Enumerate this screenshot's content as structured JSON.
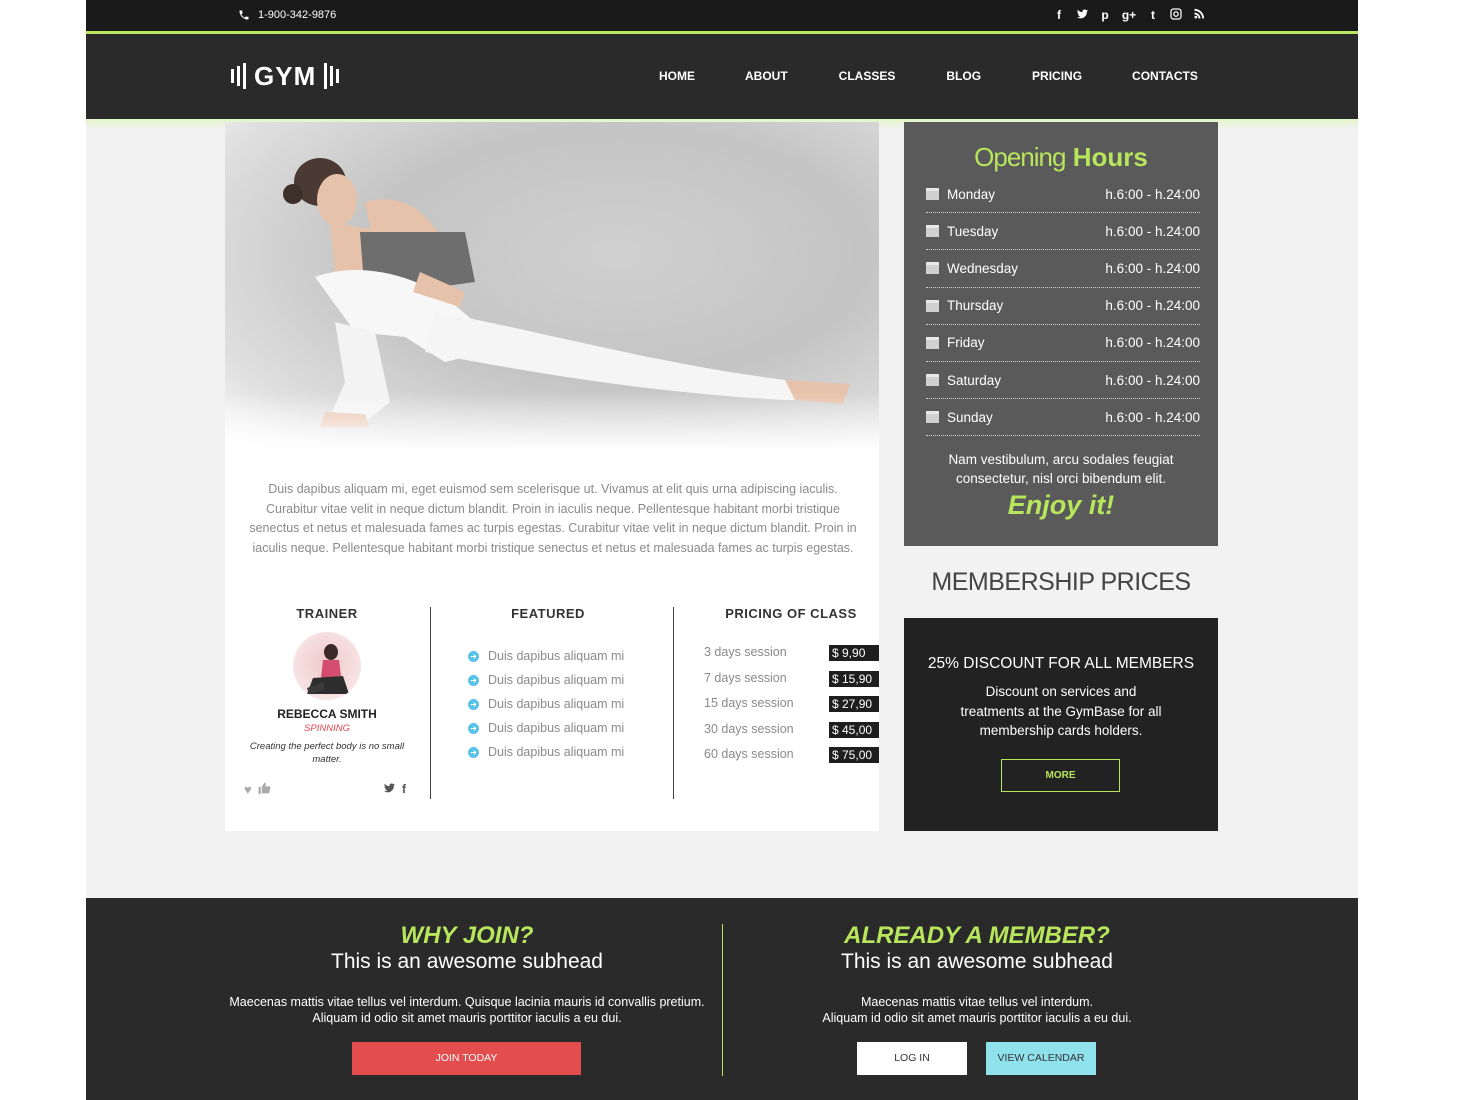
{
  "topbar": {
    "phone": "1-900-342-9876",
    "social_icons": [
      "facebook-icon",
      "twitter-icon",
      "pinterest-icon",
      "google-plus-icon",
      "tumblr-icon",
      "instagram-icon",
      "rss-icon"
    ]
  },
  "header": {
    "logo": "GYM",
    "nav": [
      "HOME",
      "ABOUT",
      "CLASSES",
      "BLOG",
      "PRICING",
      "CONTACTS"
    ]
  },
  "main": {
    "intro": "Duis dapibus aliquam mi, eget euismod sem scelerisque ut. Vivamus at elit quis urna adipiscing iaculis. Curabitur vitae velit in neque dictum blandit. Proin in iaculis neque. Pellentesque habitant morbi tristique senectus et netus et malesuada fames ac turpis egestas. Curabitur vitae velit in neque dictum blandit. Proin in iaculis neque. Pellentesque habitant morbi tristique senectus et netus et malesuada fames ac turpis egestas.",
    "trainer": {
      "heading": "TRAINER",
      "name": "REBECCA SMITH",
      "role": "SPINNING",
      "quote": "Creating the perfect body is no small matter."
    },
    "featured": {
      "heading": "FEATURED",
      "items": [
        "Duis dapibus aliquam mi",
        "Duis dapibus aliquam mi",
        "Duis dapibus aliquam mi",
        "Duis dapibus aliquam mi",
        "Duis dapibus aliquam mi"
      ]
    },
    "pricing": {
      "heading": "PRICING OF CLASS",
      "items": [
        {
          "label": "3 days session",
          "price": "$ 9,90"
        },
        {
          "label": "7 days session",
          "price": "$ 15,90"
        },
        {
          "label": "15 days session",
          "price": "$ 27,90"
        },
        {
          "label": "30 days session",
          "price": "$ 45,00"
        },
        {
          "label": "60 days session",
          "price": "$ 75,00"
        }
      ]
    }
  },
  "hours": {
    "title_light": "Opening",
    "title_bold": "Hours",
    "days": [
      {
        "day": "Monday",
        "time": "h.6:00 - h.24:00"
      },
      {
        "day": "Tuesday",
        "time": "h.6:00 - h.24:00"
      },
      {
        "day": "Wednesday",
        "time": "h.6:00 - h.24:00"
      },
      {
        "day": "Thursday",
        "time": "h.6:00 - h.24:00"
      },
      {
        "day": "Friday",
        "time": "h.6:00 - h.24:00"
      },
      {
        "day": "Saturday",
        "time": "h.6:00 - h.24:00"
      },
      {
        "day": "Sunday",
        "time": "h.6:00 - h.24:00"
      }
    ],
    "note": "Nam vestibulum, arcu sodales feugiat consectetur, nisl orci bibendum elit.",
    "enjoy": "Enjoy it!"
  },
  "membership": {
    "title": "MEMBERSHIP PRICES",
    "discount_title": "25% DISCOUNT FOR ALL MEMBERS",
    "discount_text": "Discount on services and treatments at the GymBase for all membership cards holders.",
    "more": "MORE"
  },
  "footer": {
    "left": {
      "heading": "WHY JOIN?",
      "subhead": "This is an awesome subhead",
      "text_line1": "Maecenas mattis vitae tellus vel interdum. Quisque lacinia mauris id convallis pretium.",
      "text_line2": "Aliquam id odio sit amet mauris porttitor iaculis a eu dui.",
      "button": "JOIN TODAY"
    },
    "right": {
      "heading": "ALREADY A MEMBER?",
      "subhead": "This is an awesome subhead",
      "text_line1": "Maecenas mattis vitae tellus vel interdum.",
      "text_line2": "Aliquam id odio sit amet mauris porttitor iaculis a eu dui.",
      "login": "LOG IN",
      "calendar": "VIEW CALENDAR"
    }
  },
  "colors": {
    "accent": "#b7e55c",
    "dark": "#2a2a2a",
    "join": "#e44d4d",
    "calendar": "#8fe1ec",
    "bullet": "#5bc2e7"
  }
}
